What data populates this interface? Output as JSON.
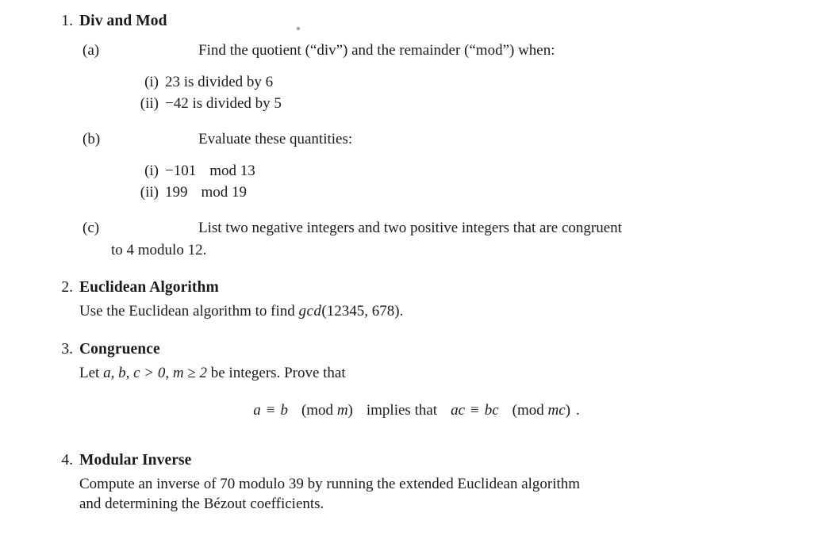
{
  "document": {
    "type": "math-homework-worksheet",
    "background_color": "#ffffff",
    "text_color": "#1a1a1a"
  },
  "problems": [
    {
      "number": "1.",
      "title": "Div and Mod",
      "parts": [
        {
          "label": "(a)",
          "text": "Find the quotient (“div”) and the remainder (“mod”) when:",
          "items": [
            {
              "label": "(i)",
              "text": "23 is divided by 6"
            },
            {
              "label": "(ii)",
              "text": "−42 is divided by 5"
            }
          ]
        },
        {
          "label": "(b)",
          "text": "Evaluate these quantities:",
          "items": [
            {
              "label": "(i)",
              "value": "−101",
              "op": "mod",
              "modulus": "13"
            },
            {
              "label": "(ii)",
              "value": "199",
              "op": "mod",
              "modulus": "19"
            }
          ]
        },
        {
          "label": "(c)",
          "text": "List two negative integers and two positive integers that are congruent",
          "text_line2": "to 4 modulo 12.",
          "items": []
        }
      ]
    },
    {
      "number": "2.",
      "title": "Euclidean Algorithm",
      "body_prefix": "Use the Euclidean algorithm to find ",
      "body_fn": "gcd",
      "body_args": "(12345, 678).",
      "gcd_a": "12345",
      "gcd_b": "678"
    },
    {
      "number": "3.",
      "title": "Congruence",
      "body_prefix": "Let ",
      "body_vars": "a, b, c > 0, m ≥ 2",
      "body_suffix": " be integers. Prove that",
      "equation": {
        "lhs_a": "a",
        "lhs_rel": "≡",
        "lhs_b": "b",
        "lhs_mod_open": "(mod ",
        "lhs_mod_var": "m",
        "lhs_mod_close": ")",
        "connector": "implies that",
        "rhs_a": "ac",
        "rhs_rel": "≡",
        "rhs_b": "bc",
        "rhs_mod_open": "(mod ",
        "rhs_mod_var": "mc",
        "rhs_mod_close": ")",
        "period": "."
      }
    },
    {
      "number": "4.",
      "title": "Modular Inverse",
      "body_line1": "Compute an inverse of 70 modulo 39 by running the extended Euclidean algorithm",
      "body_line2": "and determining the Bézout coefficients."
    }
  ]
}
